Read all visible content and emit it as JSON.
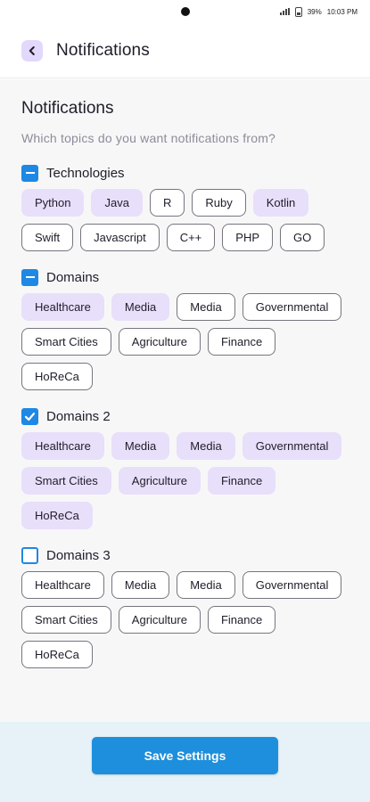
{
  "status_bar": {
    "battery": "39%",
    "time": "10:03 PM"
  },
  "app_bar": {
    "title": "Notifications",
    "back_icon": "chevron-left-icon"
  },
  "content": {
    "section_title": "Notifications",
    "subtitle": "Which topics do you want notifications from?",
    "groups": [
      {
        "label": "Technologies",
        "state": "indeterminate",
        "chips": [
          {
            "label": "Python",
            "selected": true
          },
          {
            "label": "Java",
            "selected": true
          },
          {
            "label": "R",
            "selected": false
          },
          {
            "label": "Ruby",
            "selected": false
          },
          {
            "label": "Kotlin",
            "selected": true
          },
          {
            "label": "Swift",
            "selected": false
          },
          {
            "label": "Javascript",
            "selected": false
          },
          {
            "label": "C++",
            "selected": false
          },
          {
            "label": "PHP",
            "selected": false
          },
          {
            "label": "GO",
            "selected": false
          }
        ]
      },
      {
        "label": "Domains",
        "state": "indeterminate",
        "chips": [
          {
            "label": "Healthcare",
            "selected": true
          },
          {
            "label": "Media",
            "selected": true
          },
          {
            "label": "Media",
            "selected": false
          },
          {
            "label": "Governmental",
            "selected": false
          },
          {
            "label": "Smart Cities",
            "selected": false
          },
          {
            "label": "Agriculture",
            "selected": false
          },
          {
            "label": "Finance",
            "selected": false
          },
          {
            "label": "HoReCa",
            "selected": false
          }
        ]
      },
      {
        "label": "Domains 2",
        "state": "checked",
        "chips": [
          {
            "label": "Healthcare",
            "selected": true
          },
          {
            "label": "Media",
            "selected": true
          },
          {
            "label": "Media",
            "selected": true
          },
          {
            "label": "Governmental",
            "selected": true
          },
          {
            "label": "Smart Cities",
            "selected": true
          },
          {
            "label": "Agriculture",
            "selected": true
          },
          {
            "label": "Finance",
            "selected": true
          },
          {
            "label": "HoReCa",
            "selected": true
          }
        ]
      },
      {
        "label": "Domains 3",
        "state": "unchecked",
        "chips": [
          {
            "label": "Healthcare",
            "selected": false
          },
          {
            "label": "Media",
            "selected": false
          },
          {
            "label": "Media",
            "selected": false
          },
          {
            "label": "Governmental",
            "selected": false
          },
          {
            "label": "Smart Cities",
            "selected": false
          },
          {
            "label": "Agriculture",
            "selected": false
          },
          {
            "label": "Finance",
            "selected": false
          },
          {
            "label": "HoReCa",
            "selected": false
          }
        ]
      }
    ]
  },
  "footer": {
    "save_label": "Save Settings"
  },
  "colors": {
    "accent": "#1e88e5",
    "chip_selected_bg": "#e8dffb",
    "back_button_bg": "#e2d8fb",
    "footer_bg": "#e6f1f8",
    "save_button_bg": "#1e8fdc"
  }
}
